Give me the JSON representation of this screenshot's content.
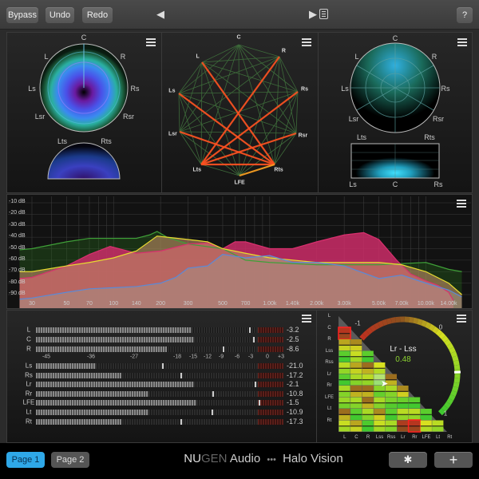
{
  "topbar": {
    "bypass": "Bypass",
    "undo": "Undo",
    "redo": "Redo",
    "prev": "◀",
    "next": "▶",
    "preset_list_icon": "list-icon",
    "help": "?"
  },
  "surround_panel": {
    "labels": {
      "C": "C",
      "L": "L",
      "R": "R",
      "Ls": "Ls",
      "Rs": "Rs",
      "Lsr": "Lsr",
      "Rsr": "Rsr",
      "Lts": "Lts",
      "Rts": "Rts"
    }
  },
  "correlation_web": {
    "nodes": [
      "C",
      "R",
      "Rs",
      "Rsr",
      "Rts",
      "LFE",
      "Lts",
      "Lsr",
      "Ls",
      "L"
    ],
    "active_links": [
      [
        "L",
        "Rts"
      ],
      [
        "Ls",
        "Rts"
      ],
      [
        "Lsr",
        "Rts"
      ],
      [
        "Lts",
        "Rts"
      ],
      [
        "LFE",
        "Rts"
      ],
      [
        "R",
        "Lts"
      ],
      [
        "Rs",
        "Lts"
      ],
      [
        "Rsr",
        "Lts"
      ]
    ],
    "link_color": "#ff5020",
    "grid_color": "#3d6a3a"
  },
  "heat_panel": {
    "labels": {
      "C": "C",
      "L": "L",
      "R": "R",
      "Ls": "Ls",
      "Rs": "Rs",
      "Lsr": "Lsr",
      "Rsr": "Rsr",
      "Lts": "Lts",
      "Rts": "Rts",
      "bLs": "Ls",
      "bC": "C",
      "bRs": "Rs"
    }
  },
  "spectrum": {
    "db_labels": [
      "-10 dB",
      "-20 dB",
      "-30 dB",
      "-40 dB",
      "-50 dB",
      "-60 dB",
      "-70 dB",
      "-80 dB",
      "-90 dB"
    ],
    "db_values": [
      -10,
      -20,
      -30,
      -40,
      -50,
      -60,
      -70,
      -80,
      -90
    ],
    "freq_labels": [
      "30",
      "50",
      "70",
      "100",
      "140",
      "200",
      "300",
      "500",
      "700",
      "1.00k",
      "1.40k",
      "2.00k",
      "3.00k",
      "5.00k",
      "7.00k",
      "10.00k",
      "14.00k"
    ],
    "freq_values": [
      30,
      50,
      70,
      100,
      140,
      200,
      300,
      500,
      700,
      1000,
      1400,
      2000,
      3000,
      5000,
      7000,
      10000,
      14000
    ],
    "series": [
      {
        "color": "#3fa038",
        "fill": "rgba(40,110,30,0.35)",
        "points": [
          [
            25,
            -51
          ],
          [
            30,
            -50
          ],
          [
            50,
            -44
          ],
          [
            70,
            -41
          ],
          [
            100,
            -41
          ],
          [
            140,
            -41
          ],
          [
            170,
            -38
          ],
          [
            190,
            -35
          ],
          [
            220,
            -40
          ],
          [
            300,
            -46
          ],
          [
            500,
            -50
          ],
          [
            700,
            -60
          ],
          [
            1000,
            -62
          ],
          [
            2000,
            -64
          ],
          [
            3000,
            -64
          ],
          [
            5000,
            -64
          ],
          [
            7000,
            -63
          ],
          [
            10000,
            -62
          ],
          [
            14000,
            -68
          ],
          [
            17000,
            -70
          ]
        ]
      },
      {
        "color": "#d8306e",
        "fill": "rgba(205,45,105,0.85)",
        "points": [
          [
            25,
            -76
          ],
          [
            30,
            -75
          ],
          [
            50,
            -65
          ],
          [
            70,
            -55
          ],
          [
            95,
            -48
          ],
          [
            140,
            -54
          ],
          [
            200,
            -52
          ],
          [
            300,
            -46
          ],
          [
            400,
            -45
          ],
          [
            500,
            -50
          ],
          [
            600,
            -44
          ],
          [
            700,
            -44
          ],
          [
            1000,
            -50
          ],
          [
            1400,
            -50
          ],
          [
            2000,
            -44
          ],
          [
            3000,
            -38
          ],
          [
            4000,
            -36
          ],
          [
            5000,
            -42
          ],
          [
            6500,
            -60
          ],
          [
            8000,
            -72
          ],
          [
            10000,
            -78
          ],
          [
            12000,
            -82
          ],
          [
            14000,
            -88
          ],
          [
            15000,
            -95
          ]
        ]
      },
      {
        "color": "#e8dc30",
        "fill": "rgba(190,140,100,0.6)",
        "points": [
          [
            25,
            -70
          ],
          [
            30,
            -70
          ],
          [
            50,
            -65
          ],
          [
            70,
            -62
          ],
          [
            100,
            -58
          ],
          [
            140,
            -52
          ],
          [
            190,
            -39
          ],
          [
            220,
            -40
          ],
          [
            300,
            -42
          ],
          [
            400,
            -44
          ],
          [
            500,
            -50
          ],
          [
            700,
            -54
          ],
          [
            1000,
            -58
          ],
          [
            2000,
            -62
          ],
          [
            3000,
            -62
          ],
          [
            5000,
            -62
          ],
          [
            7000,
            -64
          ],
          [
            10000,
            -70
          ],
          [
            14000,
            -80
          ],
          [
            17000,
            -90
          ]
        ]
      },
      {
        "color": "#5a8ad8",
        "fill": "rgba(165,150,140,0.45)",
        "points": [
          [
            25,
            -94
          ],
          [
            30,
            -93
          ],
          [
            50,
            -88
          ],
          [
            70,
            -85
          ],
          [
            100,
            -84
          ],
          [
            140,
            -83
          ],
          [
            200,
            -80
          ],
          [
            250,
            -75
          ],
          [
            300,
            -67
          ],
          [
            400,
            -65
          ],
          [
            500,
            -55
          ],
          [
            700,
            -58
          ],
          [
            1000,
            -56
          ],
          [
            1400,
            -62
          ],
          [
            2000,
            -62
          ],
          [
            3000,
            -65
          ],
          [
            5000,
            -76
          ],
          [
            7000,
            -73
          ],
          [
            10000,
            -80
          ],
          [
            14000,
            -86
          ],
          [
            17000,
            -92
          ]
        ]
      }
    ]
  },
  "meters": {
    "scale": [
      "-45",
      "-36",
      "-27",
      "-18",
      "-15",
      "-12",
      "-9",
      "-6",
      "-3",
      "0",
      "+3"
    ],
    "channels": [
      {
        "name": "L",
        "level_db": -15.3,
        "peak_db": -3.2,
        "value": "-3.2"
      },
      {
        "name": "C",
        "level_db": -14.9,
        "peak_db": -2.5,
        "value": "-2.5"
      },
      {
        "name": "R",
        "level_db": -20.2,
        "peak_db": -8.6,
        "value": "-8.6"
      },
      {
        "name": "Ls",
        "level_db": -35,
        "peak_db": -21.0,
        "value": "-21.0"
      },
      {
        "name": "Rs",
        "level_db": -29.6,
        "peak_db": -17.2,
        "value": "-17.2"
      },
      {
        "name": "Lr",
        "level_db": -14.9,
        "peak_db": -2.1,
        "value": "-2.1"
      },
      {
        "name": "Rr",
        "level_db": -24,
        "peak_db": -10.8,
        "value": "-10.8"
      },
      {
        "name": "LFE",
        "level_db": -14.4,
        "peak_db": -1.5,
        "value": "-1.5"
      },
      {
        "name": "Lt",
        "level_db": -24,
        "peak_db": -10.9,
        "value": "-10.9"
      },
      {
        "name": "Rt",
        "level_db": -29.6,
        "peak_db": -17.3,
        "value": "-17.3"
      }
    ]
  },
  "matrix": {
    "channels": [
      "L",
      "C",
      "R",
      "Lss",
      "Rss",
      "Lr",
      "Rr",
      "LFE",
      "Lt",
      "Rt"
    ],
    "values": [
      [],
      [
        -0.9
      ],
      [
        -0.2,
        -0.3
      ],
      [
        0.8,
        0.1,
        0.8
      ],
      [
        0.2,
        -0.2,
        -0.4,
        0.0
      ],
      [
        0.8,
        0.3,
        0.2,
        0.48,
        -0.4
      ],
      [
        0.3,
        -0.4,
        -0.4,
        0.5,
        0.3,
        -0.3
      ],
      [
        0.4,
        0.3,
        -0.4,
        0.3,
        0.6,
        0.7,
        0.8
      ],
      [
        -0.4,
        0.8,
        0.3,
        -0.3,
        0.8,
        0.2,
        0.2,
        0.8
      ],
      [
        0.1,
        -0.2,
        0.9,
        0.1,
        0.3,
        -0.8,
        -0.9,
        0.0,
        0.2
      ]
    ],
    "selected_pair": "Lr - Lss",
    "selected_value": "0.48",
    "selected_value_num": 0.48,
    "gauge_min": "-1",
    "gauge_mid": "0",
    "gauge_max": "1",
    "colors": {
      "negative": "#c0301f",
      "zero": "#d8e020",
      "positive": "#3cc830"
    }
  },
  "bottombar": {
    "page1": "Page 1",
    "page2": "Page 2",
    "brand_nu": "NU",
    "brand_gen": "GEN",
    "brand_audio": "Audio",
    "dots": "•••",
    "product": "Halo Vision",
    "settings_icon": "gear-icon",
    "add_icon": "plus-icon",
    "accent": "#2fa8e8"
  }
}
